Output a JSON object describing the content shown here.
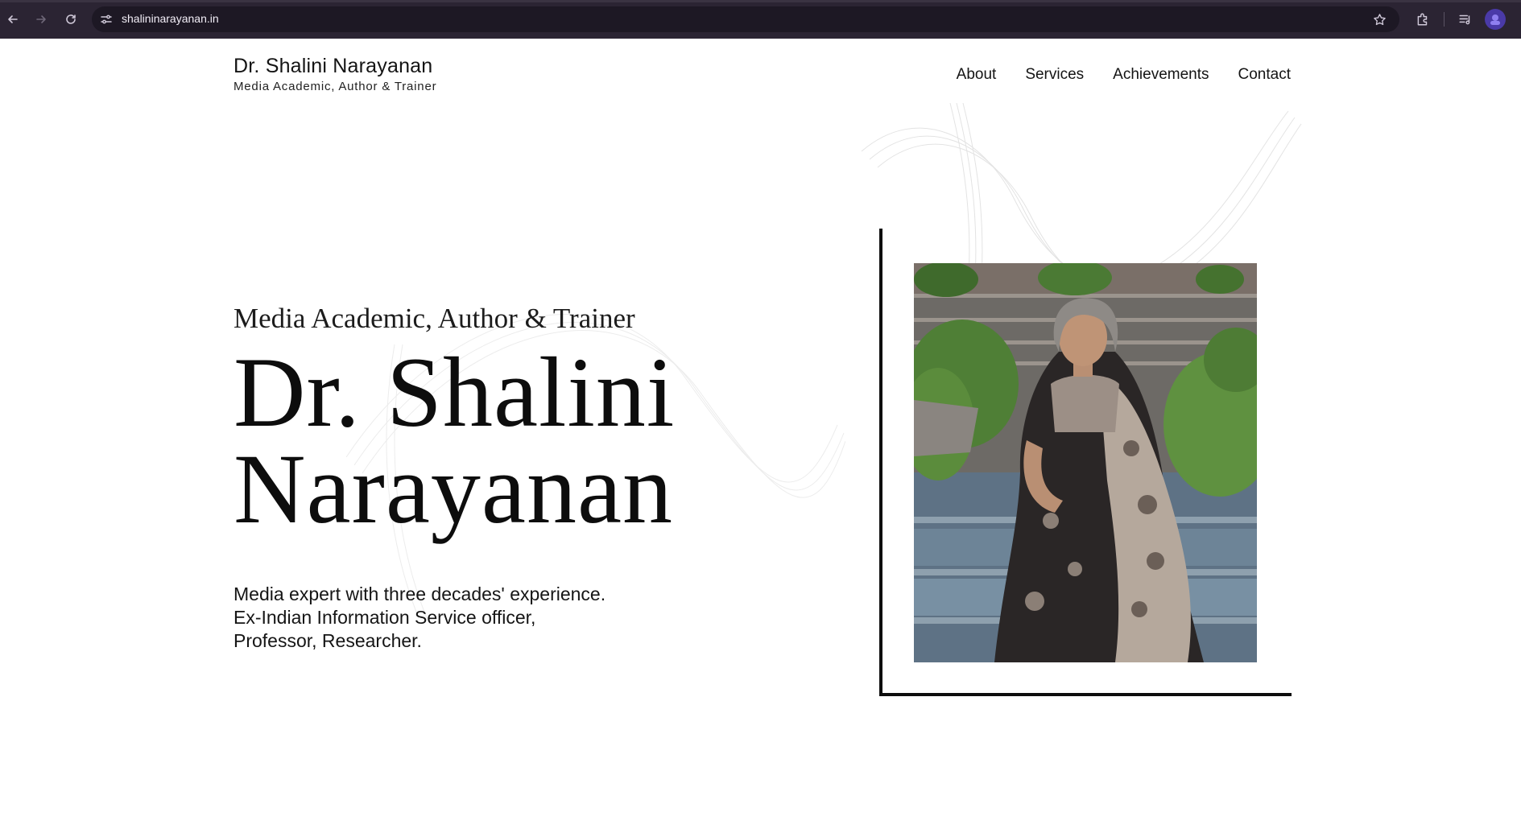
{
  "browser": {
    "url": "shalininarayanan.in"
  },
  "header": {
    "brand_name": "Dr. Shalini Narayanan",
    "brand_tagline": "Media Academic, Author & Trainer",
    "nav": [
      {
        "label": "About"
      },
      {
        "label": "Services"
      },
      {
        "label": "Achievements"
      },
      {
        "label": "Contact"
      }
    ]
  },
  "hero": {
    "eyebrow": "Media Academic, Author & Trainer",
    "name_line1": "Dr. Shalini",
    "name_line2": "Narayanan",
    "description": [
      "Media expert with three decades' experience.",
      "Ex-Indian Information Service officer,",
      "Professor, Researcher."
    ]
  },
  "colors": {
    "chrome_bg": "#2b2433",
    "omnibox_bg": "#1d1824",
    "text": "#141414",
    "frame": "#0d0d0d",
    "page_bg": "#ffffff"
  }
}
